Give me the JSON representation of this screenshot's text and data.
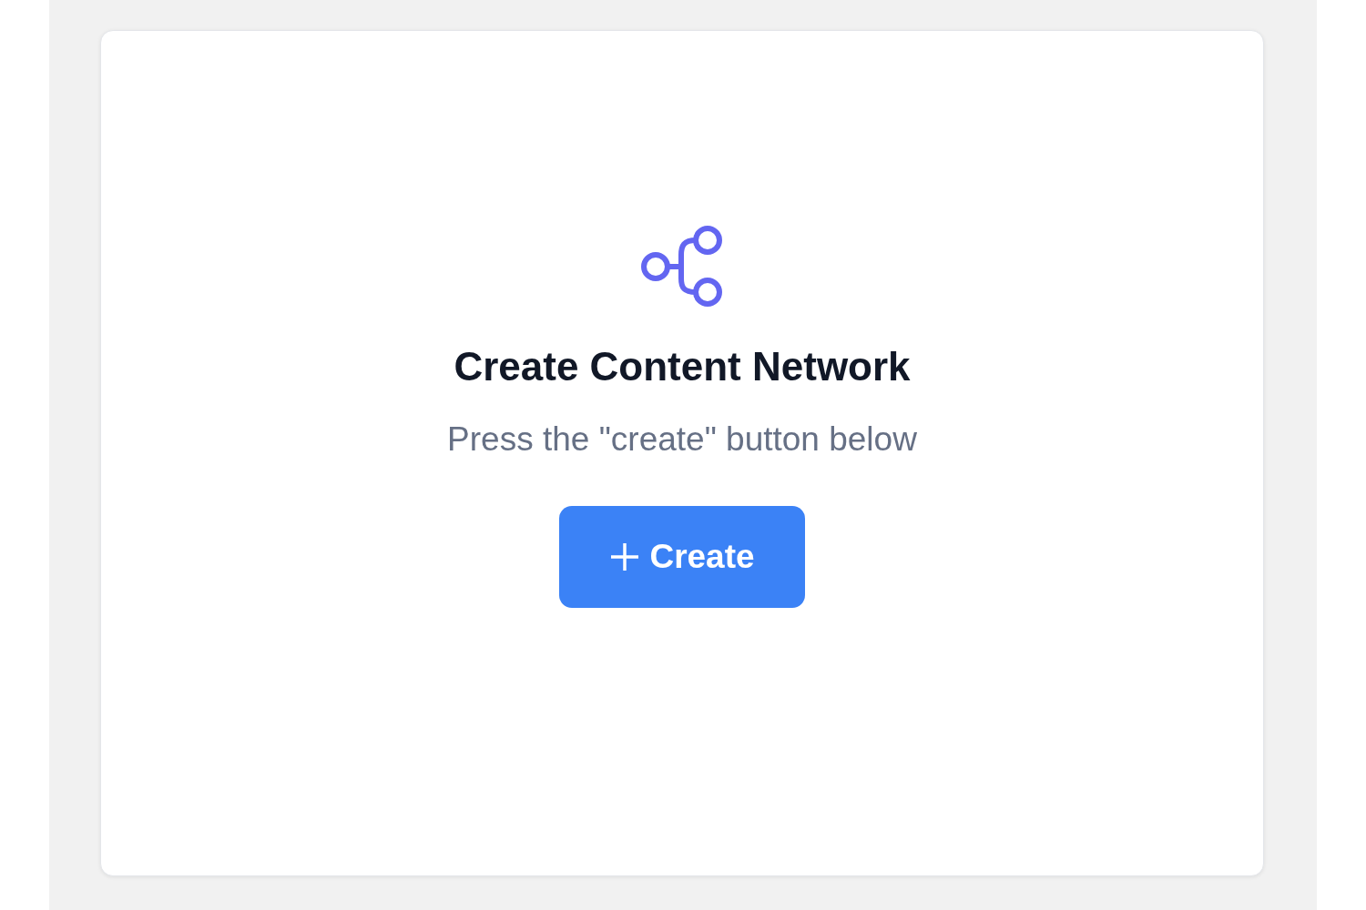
{
  "empty_state": {
    "title": "Create Content Network",
    "description": "Press the \"create\" button below",
    "button": {
      "label": "Create"
    }
  }
}
